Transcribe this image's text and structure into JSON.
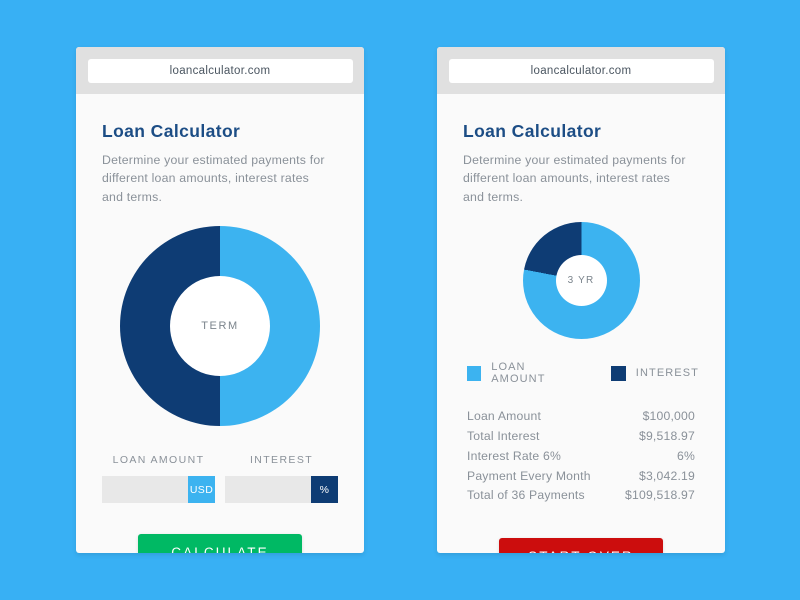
{
  "colors": {
    "page_background": "#38b0f4",
    "light_blue": "#3cb3f0",
    "navy": "#0e3c74",
    "green": "#00b964",
    "red": "#cc0d0d",
    "card": "#fafafa",
    "chrome": "#e0e0e0",
    "input": "#e8e8e8",
    "title_text": "#1c4d85",
    "body_text": "#8a9199"
  },
  "browser": {
    "url": "loancalculator.com"
  },
  "app": {
    "title": "Loan Calculator",
    "description": "Determine your estimated payments for different loan amounts, interest rates and terms."
  },
  "input_state": {
    "donut_center_label": "TERM",
    "fields": [
      {
        "label": "LOAN AMOUNT",
        "value": "",
        "placeholder": "",
        "badge": "USD",
        "badge_color": "#3cb3f0"
      },
      {
        "label": "INTEREST",
        "value": "",
        "placeholder": "",
        "badge": "%",
        "badge_color": "#0e3c74"
      }
    ],
    "submit_label": "CALCULATE"
  },
  "result_state": {
    "donut_center_label": "3 YR",
    "legend": [
      {
        "label": "LOAN AMOUNT",
        "color": "#3cb3f0"
      },
      {
        "label": "INTEREST",
        "color": "#0e3c74"
      }
    ],
    "rows": [
      {
        "label": "Loan Amount",
        "value": "$100,000"
      },
      {
        "label": "Total Interest",
        "value": "$9,518.97"
      },
      {
        "label": "Interest Rate 6%",
        "value": "6%"
      },
      {
        "label": "Payment Every Month",
        "value": "$3,042.19"
      },
      {
        "label": "Total of 36 Payments",
        "value": "$109,518.97"
      }
    ],
    "reset_label": "START OVER"
  },
  "chart_data": [
    {
      "type": "pie",
      "title": "TERM",
      "labels": [
        "Loan Amount",
        "Interest"
      ],
      "values": [
        50,
        50
      ],
      "colors": [
        "#3cb3f0",
        "#0e3c74"
      ],
      "donut": true,
      "inner_radius_ratio": 0.5,
      "start_angle": 0,
      "direction": "clockwise",
      "legend": "none"
    },
    {
      "type": "pie",
      "title": "3 YR",
      "labels": [
        "Loan Amount",
        "Interest"
      ],
      "values": [
        78,
        22
      ],
      "colors": [
        "#3cb3f0",
        "#0e3c74"
      ],
      "donut": true,
      "inner_radius_ratio": 0.44,
      "start_angle": 0,
      "direction": "clockwise",
      "legend": "bottom"
    }
  ]
}
